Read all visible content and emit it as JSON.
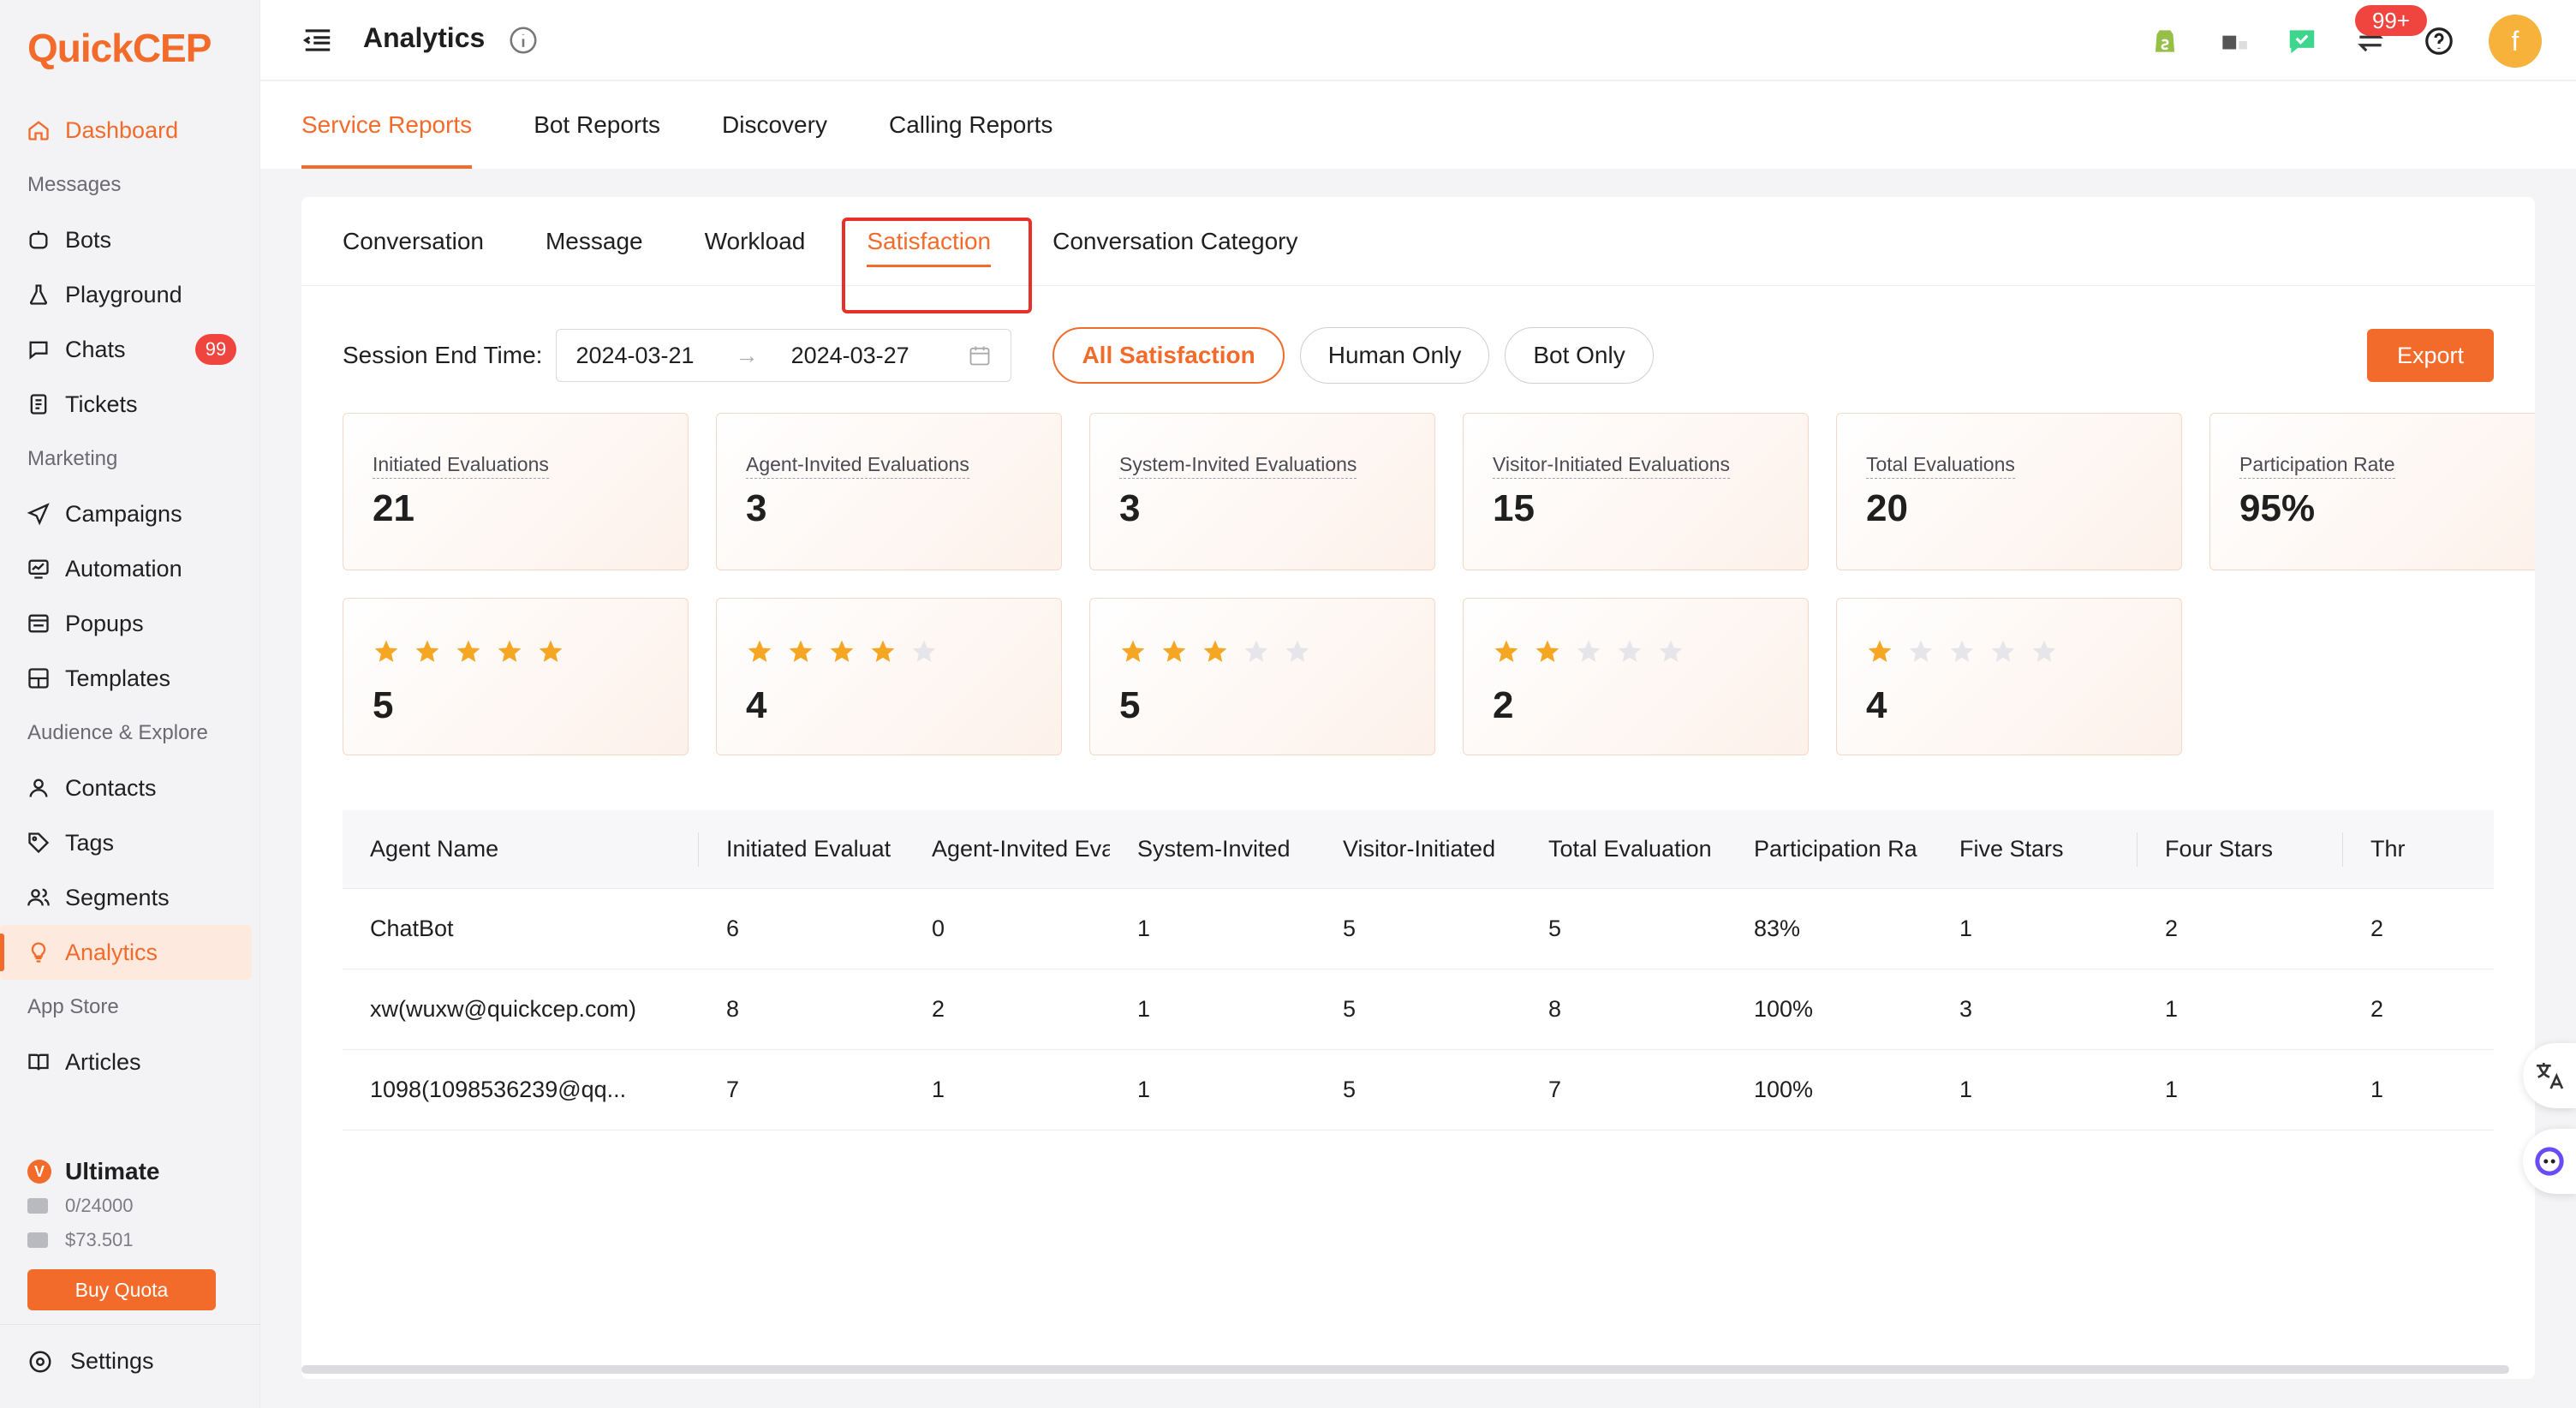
{
  "app": {
    "logo_q": "Q",
    "logo_rest": "uickCEP"
  },
  "sidebar": {
    "home": {
      "label": "Dashboard",
      "icon": "home-icon"
    },
    "groups": [
      {
        "title": "Messages",
        "items": [
          {
            "label": "Bots",
            "icon": "bot-icon"
          },
          {
            "label": "Playground",
            "icon": "playground-icon"
          },
          {
            "label": "Chats",
            "icon": "chat-icon",
            "badge": "99"
          },
          {
            "label": "Tickets",
            "icon": "ticket-icon"
          }
        ]
      },
      {
        "title": "Marketing",
        "items": [
          {
            "label": "Campaigns",
            "icon": "campaign-icon"
          },
          {
            "label": "Automation",
            "icon": "automation-icon"
          },
          {
            "label": "Popups",
            "icon": "popup-icon"
          },
          {
            "label": "Templates",
            "icon": "template-icon"
          }
        ]
      },
      {
        "title": "Audience & Explore",
        "items": [
          {
            "label": "Contacts",
            "icon": "contact-icon"
          },
          {
            "label": "Tags",
            "icon": "tag-icon"
          },
          {
            "label": "Segments",
            "icon": "segment-icon"
          },
          {
            "label": "Analytics",
            "icon": "analytics-icon",
            "active": true
          }
        ]
      },
      {
        "title": "App Store",
        "items": [
          {
            "label": "Articles",
            "icon": "article-icon"
          }
        ]
      }
    ],
    "plan": {
      "badge": "V",
      "name": "Ultimate",
      "quota_messages": "0/24000",
      "quota_balance": "$73.501",
      "buy_label": "Buy Quota"
    },
    "settings_label": "Settings"
  },
  "topbar": {
    "title": "Analytics",
    "notification_badge": "99+",
    "avatar_initial": "f"
  },
  "report_tabs": [
    "Service Reports",
    "Bot Reports",
    "Discovery",
    "Calling Reports"
  ],
  "sub_tabs": [
    "Conversation",
    "Message",
    "Workload",
    "Satisfaction",
    "Conversation Category"
  ],
  "filters": {
    "session_label": "Session End Time",
    "colon": ":",
    "start_date": "2024-03-21",
    "end_date": "2024-03-27",
    "range_arrow": "→",
    "segments": [
      "All Satisfaction",
      "Human Only",
      "Bot Only"
    ],
    "export_label": "Export"
  },
  "stats": [
    {
      "label": "Initiated Evaluations",
      "value": "21"
    },
    {
      "label": "Agent-Invited Evaluations",
      "value": "3"
    },
    {
      "label": "System-Invited Evaluations",
      "value": "3"
    },
    {
      "label": "Visitor-Initiated Evaluations",
      "value": "15"
    },
    {
      "label": "Total Evaluations",
      "value": "20"
    },
    {
      "label": "Participation Rate",
      "value": "95%"
    }
  ],
  "star_stats": [
    {
      "stars": 5,
      "value": "5"
    },
    {
      "stars": 4,
      "value": "4"
    },
    {
      "stars": 3,
      "value": "5"
    },
    {
      "stars": 2,
      "value": "2"
    },
    {
      "stars": 1,
      "value": "4"
    }
  ],
  "colors": {
    "accent": "#f26b2b",
    "star_filled": "#f5a623",
    "star_empty": "#e6e6ea",
    "highlight": "#e8302a"
  },
  "table": {
    "headers": [
      "Agent Name",
      "Initiated Evaluat",
      "Agent-Invited Evaluation",
      "System-Invited",
      "Visitor-Initiated",
      "Total Evaluation",
      "Participation Ra",
      "Five Stars",
      "Four Stars",
      "Thr"
    ],
    "rows": [
      [
        "ChatBot",
        "6",
        "0",
        "1",
        "5",
        "5",
        "83%",
        "1",
        "2",
        "2"
      ],
      [
        "xw(wuxw@quickcep.com)",
        "8",
        "2",
        "1",
        "5",
        "8",
        "100%",
        "3",
        "1",
        "2"
      ],
      [
        "1098(1098536239@qq...",
        "7",
        "1",
        "1",
        "5",
        "7",
        "100%",
        "1",
        "1",
        "1"
      ]
    ]
  }
}
